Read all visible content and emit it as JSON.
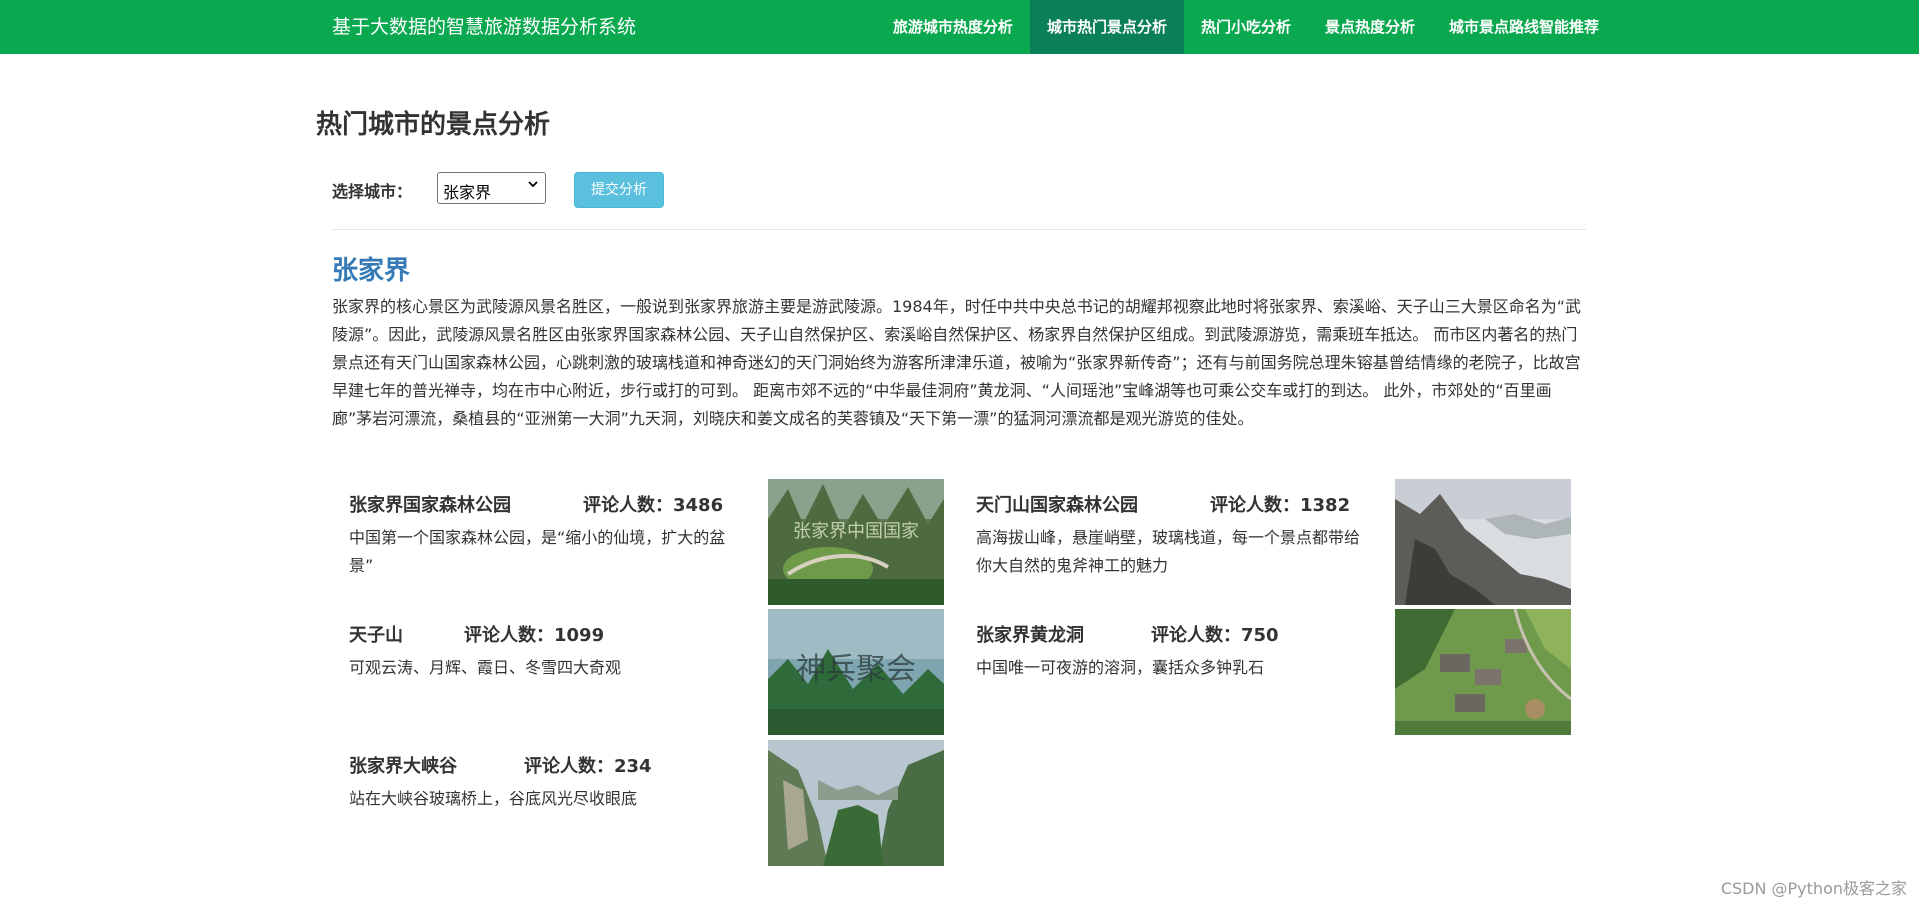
{
  "app": {
    "title": "基于大数据的智慧旅游数据分析系统"
  },
  "nav": {
    "items": [
      {
        "label": "旅游城市热度分析"
      },
      {
        "label": "城市热门景点分析"
      },
      {
        "label": "热门小吃分析"
      },
      {
        "label": "景点热度分析"
      },
      {
        "label": "城市景点路线智能推荐"
      }
    ],
    "active_index": 1
  },
  "page": {
    "heading": "热门城市的景点分析"
  },
  "form": {
    "city_label": "选择城市：",
    "city_selected": "张家界",
    "submit_label": "提交分析"
  },
  "city": {
    "name": "张家界",
    "description": "张家界的核心景区为武陵源风景名胜区，一般说到张家界旅游主要是游武陵源。1984年，时任中共中央总书记的胡耀邦视察此地时将张家界、索溪峪、天子山三大景区命名为“武陵源”。因此，武陵源风景名胜区由张家界国家森林公园、天子山自然保护区、索溪峪自然保护区、杨家界自然保护区组成。到武陵源游览，需乘班车抵达。 而市区内著名的热门景点还有天门山国家森林公园，心跳刺激的玻璃栈道和神奇迷幻的天门洞始终为游客所津津乐道，被喻为“张家界新传奇”；还有与前国务院总理朱镕基曾结情缘的老院子，比故宫早建七年的普光禅寺，均在市中心附近，步行或打的可到。 距离市郊不远的“中华最佳洞府”黄龙洞、“人间瑶池”宝峰湖等也可乘公交车或打的到达。 此外，市郊处的“百里画廊”茅岩河漂流，桑植县的“亚洲第一大洞”九天洞，刘晓庆和姜文成名的芙蓉镇及“天下第一漂”的猛洞河漂流都是观光游览的佳处。"
  },
  "spots": [
    {
      "name": "张家界国家森林公园",
      "count_label": "评论人数：3486",
      "desc": "中国第一个国家森林公园，是“缩小的仙境，扩大的盆景”",
      "image_caption": "张家界中国国家"
    },
    {
      "name": "天门山国家森林公园",
      "count_label": "评论人数：1382",
      "desc": "高海拔山峰，悬崖峭壁，玻璃栈道，每一个景点都带给你大自然的鬼斧神工的魅力",
      "image_caption": ""
    },
    {
      "name": "天子山",
      "count_label": "评论人数：1099",
      "desc": "可观云涛、月辉、霞日、冬雪四大奇观",
      "image_caption": "神兵聚会"
    },
    {
      "name": "张家界黄龙洞",
      "count_label": "评论人数：750",
      "desc": "中国唯一可夜游的溶洞，囊括众多钟乳石",
      "image_caption": ""
    },
    {
      "name": "张家界大峡谷",
      "count_label": "评论人数：234",
      "desc": "站在大峡谷玻璃桥上，谷底风光尽收眼底",
      "image_caption": ""
    }
  ],
  "watermark": "CSDN @Python极客之家",
  "colors": {
    "navbar": "#0aa84f",
    "nav_active": "#0a7f58",
    "city_title": "#337ab7",
    "submit_button": "#5bc0de"
  }
}
